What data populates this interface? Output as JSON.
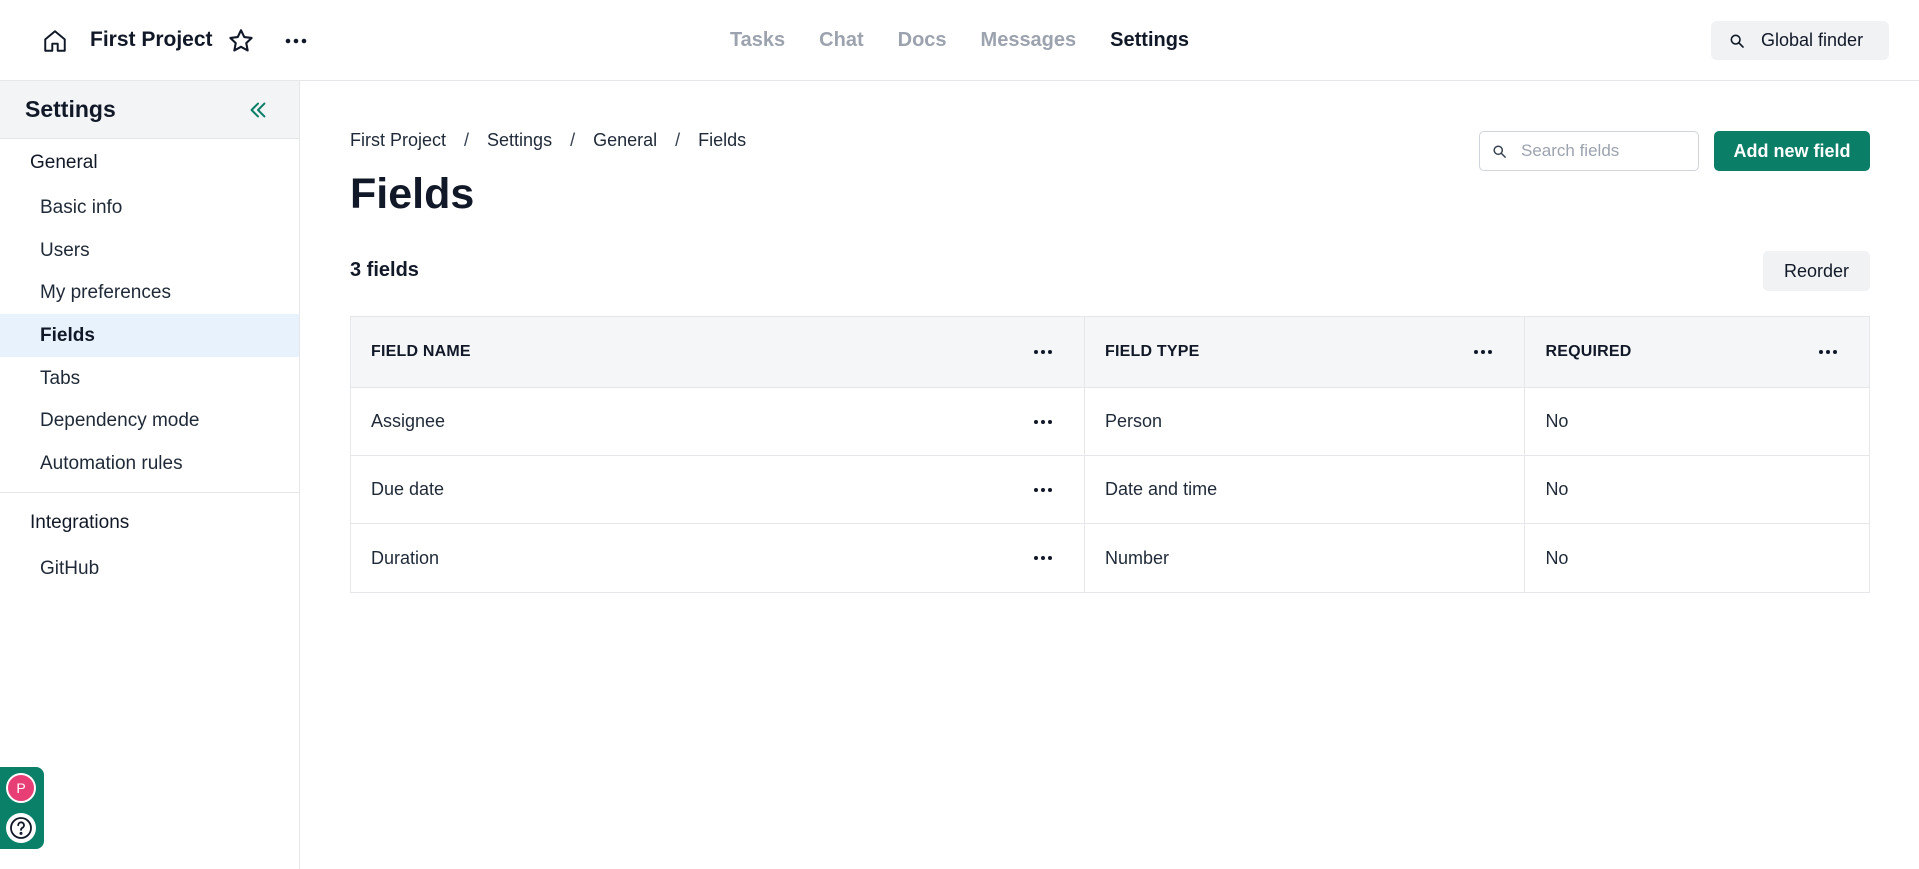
{
  "header": {
    "project_title": "First Project",
    "nav": [
      {
        "label": "Tasks",
        "active": false
      },
      {
        "label": "Chat",
        "active": false
      },
      {
        "label": "Docs",
        "active": false
      },
      {
        "label": "Messages",
        "active": false
      },
      {
        "label": "Settings",
        "active": true
      }
    ],
    "global_finder_label": "Global finder"
  },
  "sidebar": {
    "title": "Settings",
    "sections": [
      {
        "label": "General",
        "items": [
          "Basic info",
          "Users",
          "My preferences",
          "Fields",
          "Tabs",
          "Dependency mode",
          "Automation rules"
        ]
      },
      {
        "label": "Integrations",
        "items": [
          "GitHub"
        ]
      }
    ],
    "active_item": "Fields"
  },
  "user": {
    "avatar_initial": "P"
  },
  "main": {
    "breadcrumb": [
      "First Project",
      "Settings",
      "General",
      "Fields"
    ],
    "breadcrumb_separator": "/",
    "page_title": "Fields",
    "search_placeholder": "Search fields",
    "search_value": "",
    "add_button_label": "Add new field",
    "count_label": "3 fields",
    "reorder_label": "Reorder",
    "table": {
      "columns": [
        "FIELD NAME",
        "FIELD TYPE",
        "REQUIRED"
      ],
      "rows": [
        [
          "Assignee",
          "Person",
          "No"
        ],
        [
          "Due date",
          "Date and time",
          "No"
        ],
        [
          "Duration",
          "Number",
          "No"
        ]
      ]
    }
  },
  "colors": {
    "accent": "#0a7e66",
    "active_item_bg": "#e8f2fd",
    "avatar_bg": "#e73e76"
  },
  "icons": {
    "home": "home-icon",
    "star": "star-icon",
    "more": "more-horizontal-icon",
    "search": "search-icon",
    "collapse": "chevrons-left-icon",
    "help": "help-circle-icon"
  }
}
